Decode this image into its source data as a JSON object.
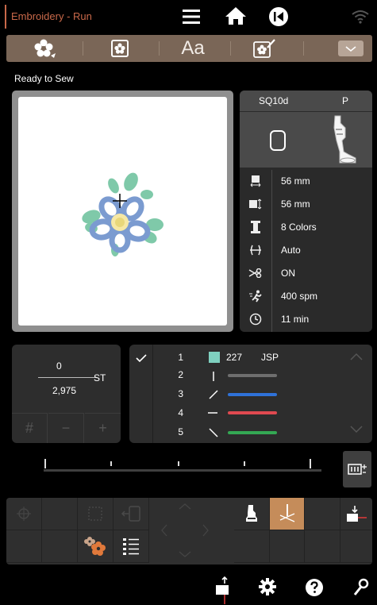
{
  "app": {
    "title": "Embroidery - Run"
  },
  "topbar": {
    "icons": [
      "menu-icon",
      "home-icon",
      "back-icon",
      "wifi-icon"
    ]
  },
  "tabs": [
    {
      "name": "design-tab",
      "icon": "flower-icon"
    },
    {
      "name": "edit-tab",
      "icon": "design-edit-icon"
    },
    {
      "name": "font-tab",
      "label": "Aa"
    },
    {
      "name": "stitch-edit-tab",
      "icon": "stitch-edit-icon"
    },
    {
      "name": "dropdown-tab",
      "icon": "chevron-down-icon"
    }
  ],
  "status": {
    "text": "Ready to Sew"
  },
  "info": {
    "hoop": "SQ10d",
    "foot": "P",
    "rows": [
      {
        "icon": "width-icon",
        "value": "56 mm"
      },
      {
        "icon": "height-icon",
        "value": "56 mm"
      },
      {
        "icon": "spool-icon",
        "value": "8 Colors"
      },
      {
        "icon": "tension-icon",
        "value": "Auto"
      },
      {
        "icon": "cutter-icon",
        "value": "ON"
      },
      {
        "icon": "speed-icon",
        "value": "400 spm"
      },
      {
        "icon": "clock-icon",
        "value": "11 min"
      }
    ]
  },
  "counter": {
    "current": "0",
    "total": "2,975",
    "unit": "ST",
    "buttons": [
      "#",
      "−",
      "+"
    ]
  },
  "colors": {
    "first_code": "227",
    "first_brand": "JSP",
    "items": [
      {
        "num": "1",
        "color": "#7fd1c0"
      },
      {
        "num": "2",
        "color": "#6e6e6e"
      },
      {
        "num": "3",
        "color": "#2f72d8"
      },
      {
        "num": "4",
        "color": "#e04950"
      },
      {
        "num": "5",
        "color": "#34a853"
      }
    ]
  },
  "progress": {
    "value": 0
  }
}
